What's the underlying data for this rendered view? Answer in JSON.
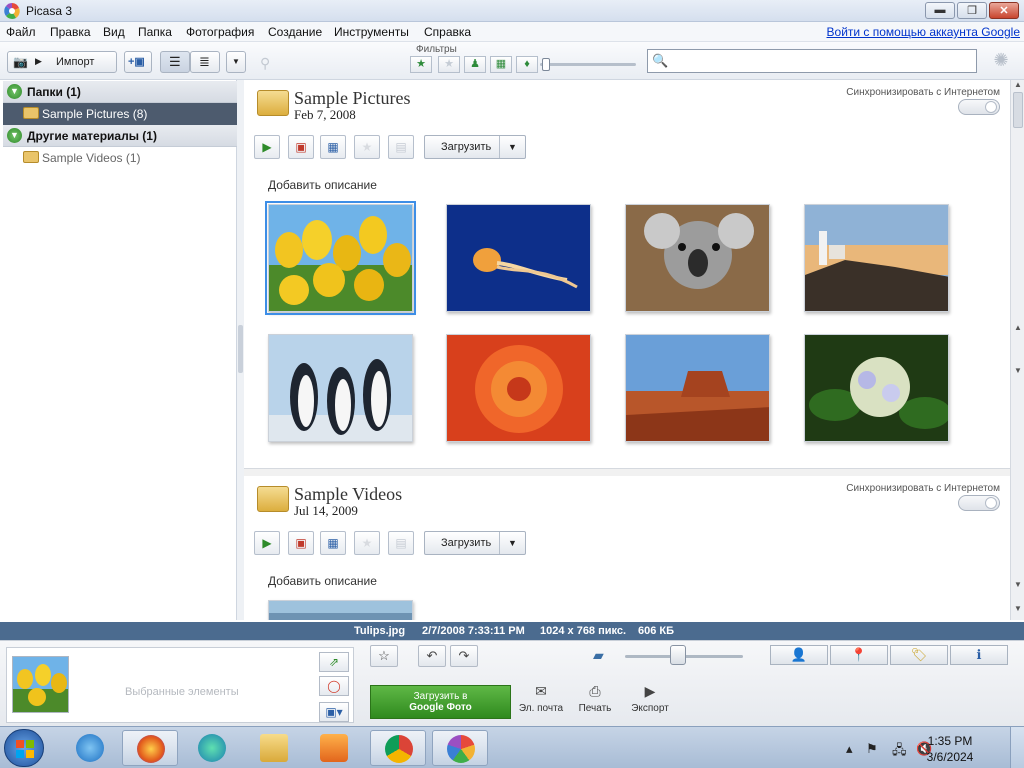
{
  "window": {
    "title": "Picasa 3",
    "minimize": "▬",
    "restore": "❐",
    "close": "✕"
  },
  "menu": {
    "items": [
      "Файл",
      "Правка",
      "Вид",
      "Папка",
      "Фотография",
      "Создание",
      "Инструменты",
      "Справка"
    ],
    "signin_link": "Войти с помощью аккаунта Google"
  },
  "toolbar": {
    "import_label": "Импорт",
    "filters_label": "Фильтры"
  },
  "search": {
    "placeholder": ""
  },
  "left_panel": {
    "groups": [
      {
        "label": "Папки (1)"
      },
      {
        "label": "Другие материалы (1)"
      }
    ],
    "folders": [
      {
        "label": "Sample Pictures (8)",
        "selected": true
      },
      {
        "label": "Sample Videos (1)",
        "selected": false
      }
    ]
  },
  "sections": [
    {
      "name": "Sample Pictures",
      "date": "Feb 7, 2008",
      "sync_label": "Синхронизировать с Интернетом",
      "upload_label": "Загрузить",
      "description_placeholder": "Добавить описание",
      "photos": [
        "tulips",
        "jellyfish",
        "koala",
        "lighthouse",
        "penguins",
        "chrysanthemum",
        "desert",
        "hydrangeas"
      ]
    },
    {
      "name": "Sample Videos",
      "date": "Jul 14, 2009",
      "sync_label": "Синхронизировать с Интернетом",
      "upload_label": "Загрузить",
      "description_placeholder": "Добавить описание",
      "photos": [
        "wildlife"
      ]
    }
  ],
  "info_bar": {
    "filename": "Tulips.jpg",
    "datetime": "2/7/2008 7:33:11 PM",
    "dimensions": "1024 x 768 пикс.",
    "size": "606 КБ"
  },
  "tray": {
    "selection_label": "Выбранные элементы",
    "google_upload_line1": "Загрузить в",
    "google_upload_line2": "Google Фото",
    "email_label": "Эл. почта",
    "print_label": "Печать",
    "export_label": "Экспорт",
    "zoom_level": 0.45
  },
  "taskbar": {
    "time": "1:35 PM",
    "date": "3/6/2024",
    "apps": [
      "start",
      "internet-explorer",
      "firefox",
      "edge",
      "file-explorer",
      "media-player",
      "chrome",
      "picasa"
    ]
  },
  "colors": {
    "accent_blue": "#4b6b8f",
    "selected_folder": "#4d5b6e",
    "google_green": "#2f8a1e",
    "selection_outline": "#3d8ee6"
  }
}
